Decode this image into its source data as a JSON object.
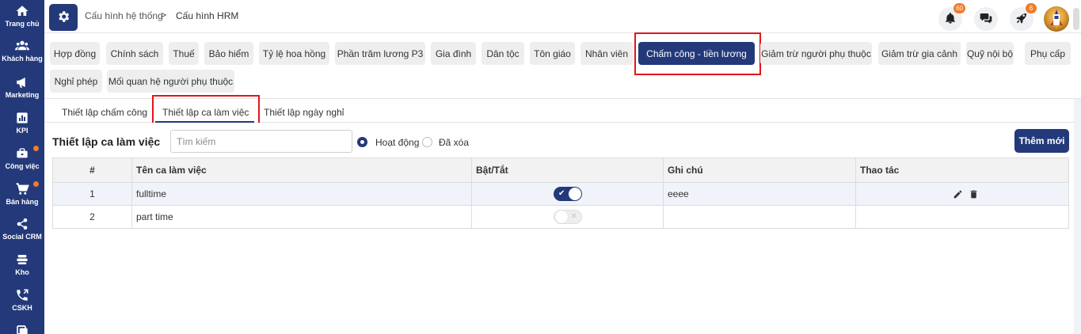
{
  "colors": {
    "primary": "#23397a",
    "accent": "#f07c2a",
    "highlight": "#e0161b"
  },
  "sidebar": {
    "items": [
      {
        "label": "Trang chủ",
        "icon": "home-icon"
      },
      {
        "label": "Khách hàng",
        "icon": "users-icon"
      },
      {
        "label": "Marketing",
        "icon": "megaphone-icon"
      },
      {
        "label": "KPI",
        "icon": "chart-icon"
      },
      {
        "label": "Công việc",
        "icon": "briefcase-icon"
      },
      {
        "label": "Bán hàng",
        "icon": "cart-icon"
      },
      {
        "label": "Social CRM",
        "icon": "share-icon"
      },
      {
        "label": "Kho",
        "icon": "warehouse-icon"
      },
      {
        "label": "CSKH",
        "icon": "phone-icon"
      }
    ]
  },
  "header": {
    "breadcrumb": [
      "Cấu hình hệ thống",
      "Cấu hình HRM"
    ],
    "breadcrumb_sep": ">",
    "notifications_count": "60",
    "rocket_count": "6"
  },
  "categories": [
    "Hợp đồng",
    "Chính sách",
    "Thuế",
    "Bảo hiểm",
    "Tỷ lệ hoa hồng",
    "Phần trăm lương P3",
    "Gia đình",
    "Dân tộc",
    "Tôn giáo",
    "Nhân viên",
    "Chấm công - tiền lương",
    "Giảm trừ người phụ thuộc",
    "Giảm trừ gia cảnh",
    "Quỹ nội bộ",
    "Phụ cấp",
    "Nghỉ phép",
    "Mối quan hệ người phụ thuộc"
  ],
  "active_category": "Chấm công - tiền lương",
  "subtabs": [
    "Thiết lập chấm công",
    "Thiết lập ca làm việc",
    "Thiết lập ngày nghỉ"
  ],
  "active_subtab": "Thiết lập ca làm việc",
  "main": {
    "title": "Thiết lập ca làm việc",
    "search_placeholder": "Tìm kiếm",
    "filter_active": "Hoạt động",
    "filter_deleted": "Đã xóa",
    "add_button": "Thêm mới"
  },
  "table": {
    "headers": [
      "#",
      "Tên ca làm việc",
      "Bật/Tắt",
      "Ghi chú",
      "Thao tác"
    ],
    "rows": [
      {
        "num": "1",
        "name": "fulltime",
        "enabled": true,
        "note": "eeee"
      },
      {
        "num": "2",
        "name": "part time",
        "enabled": false,
        "note": ""
      }
    ]
  }
}
